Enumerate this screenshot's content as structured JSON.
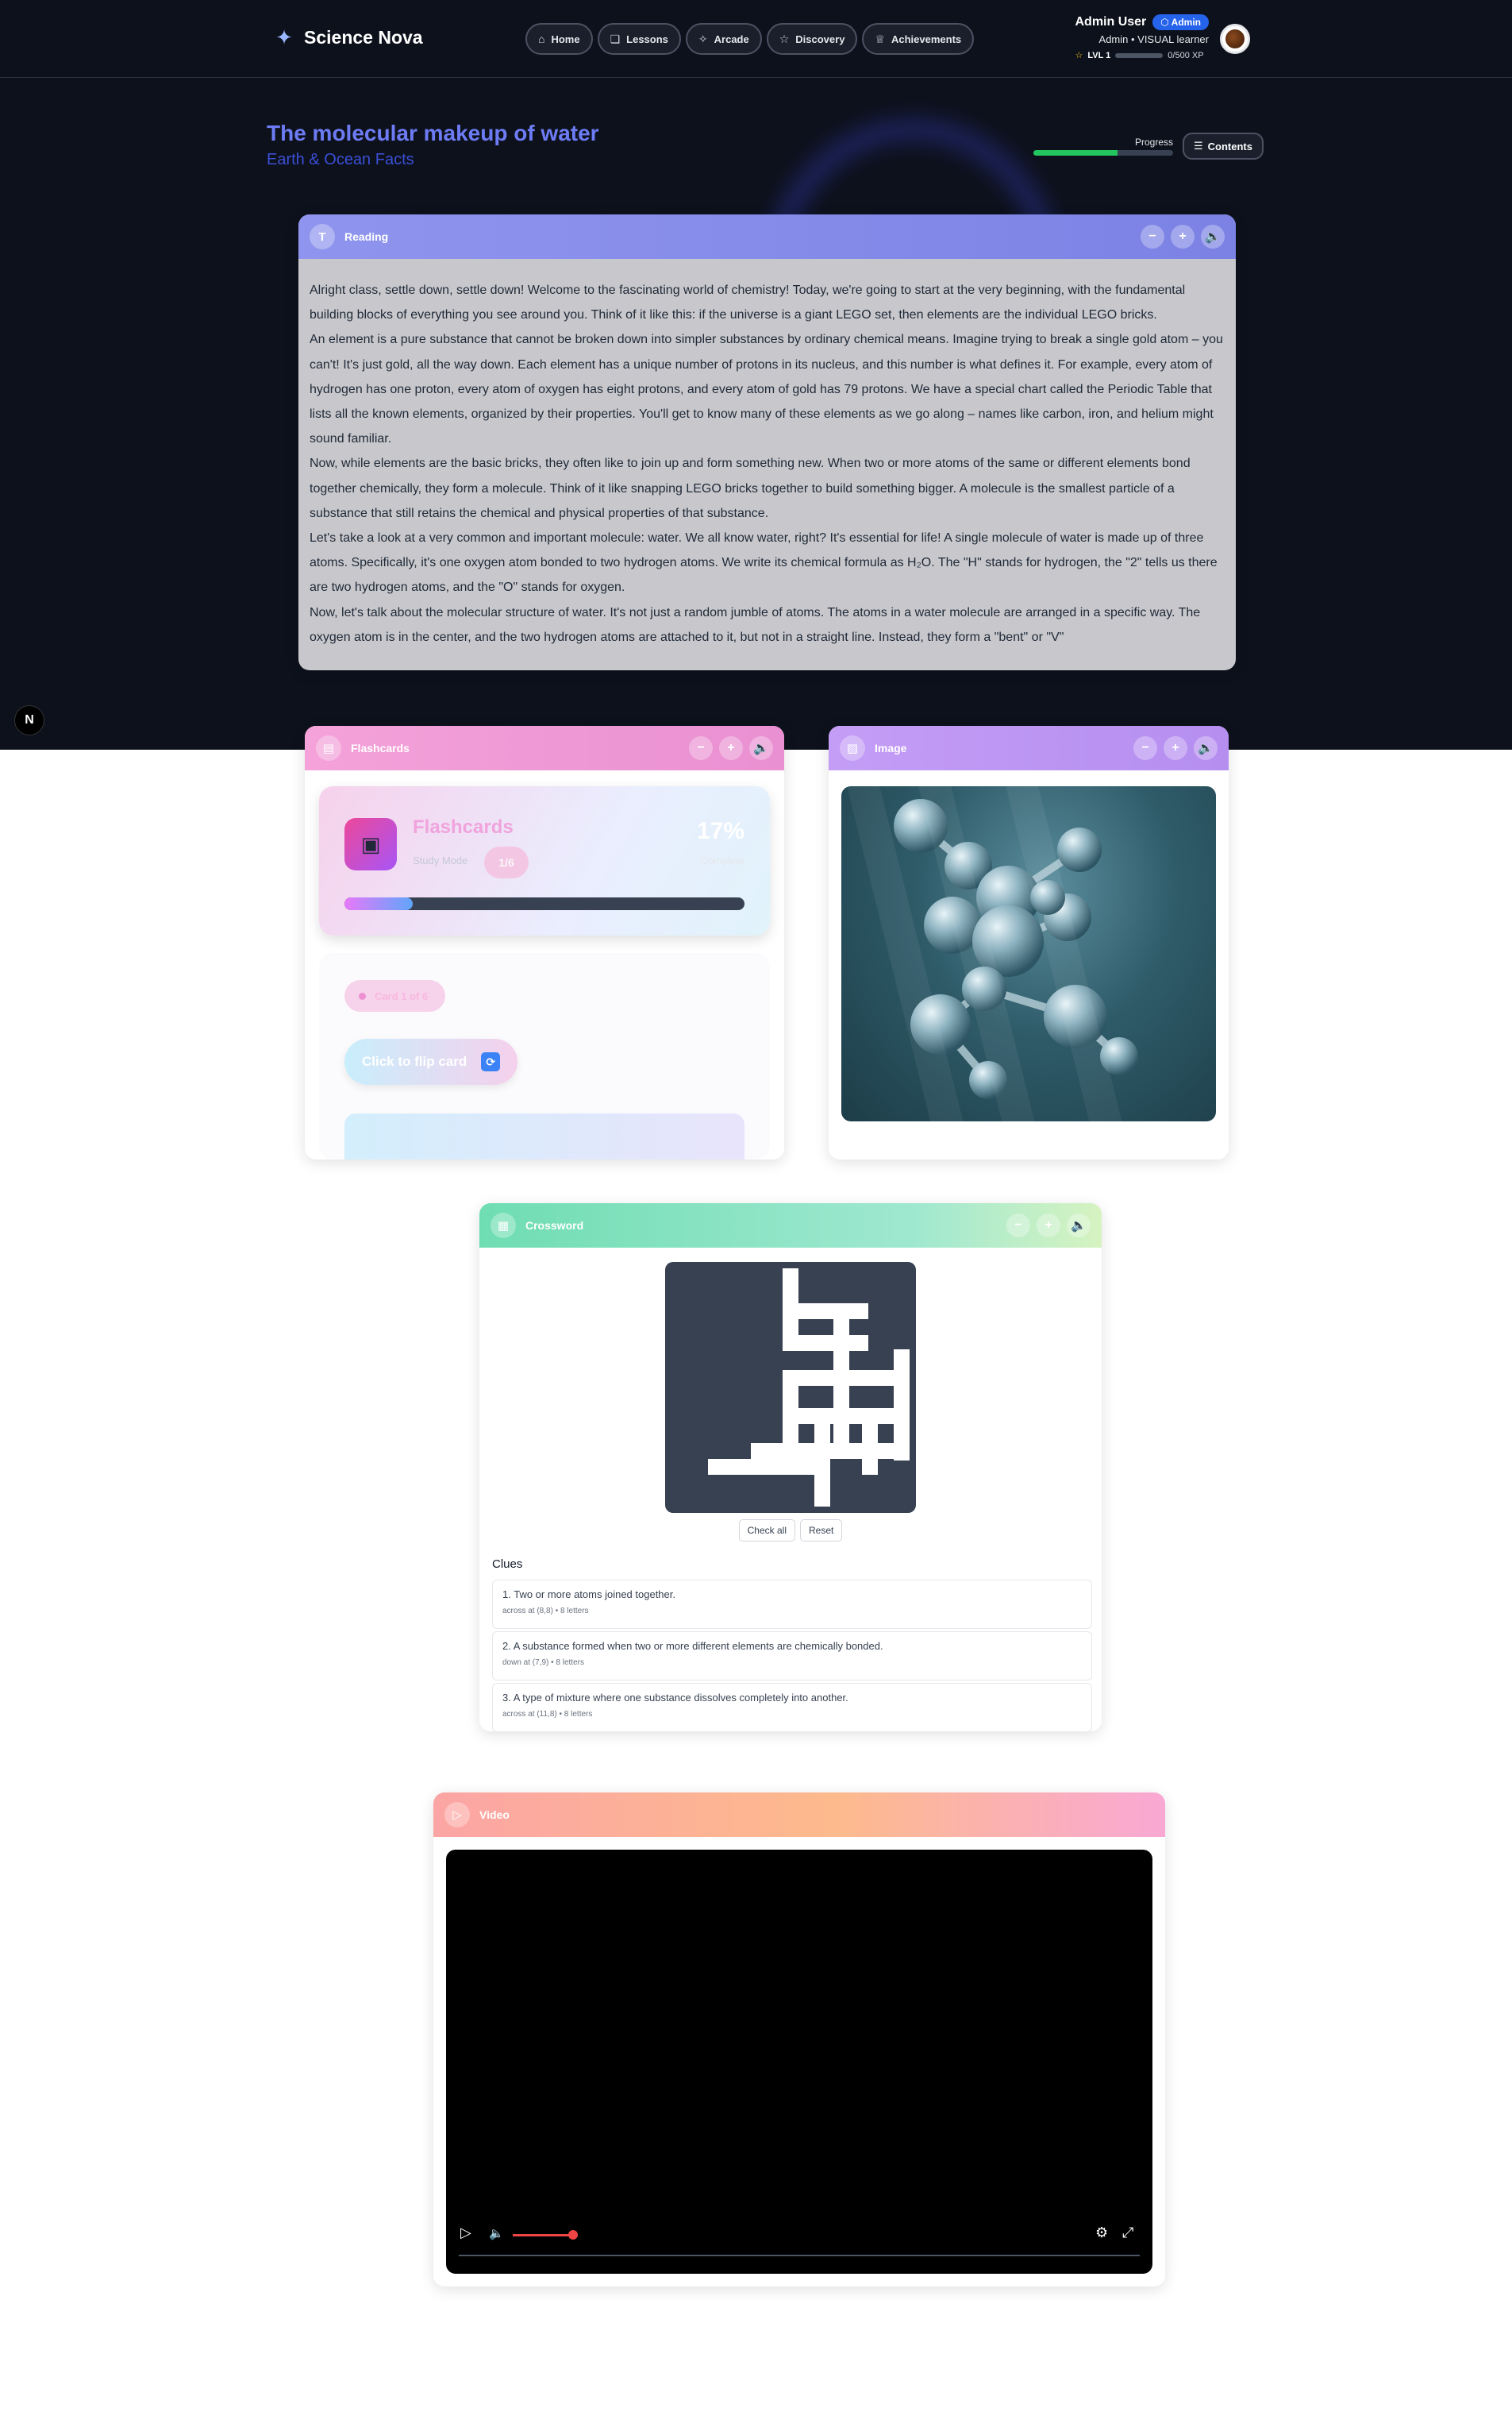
{
  "brand": {
    "name": "Science Nova",
    "icon": "sparkles-icon"
  },
  "nav": [
    {
      "label": "Home",
      "icon": "home-icon"
    },
    {
      "label": "Lessons",
      "icon": "book-icon"
    },
    {
      "label": "Arcade",
      "icon": "sparkles-icon"
    },
    {
      "label": "Discovery",
      "icon": "star-icon"
    },
    {
      "label": "Achievements",
      "icon": "trophy-icon"
    }
  ],
  "user": {
    "name": "Admin User",
    "badge": "Admin",
    "role": "Admin • VISUAL learner",
    "level": "LVL 1",
    "xp": "0/500 XP",
    "xp_fraction": 0.0
  },
  "lesson": {
    "title": "The molecular makeup of water",
    "subtitle": "Earth & Ocean Facts",
    "progress_label": "Progress",
    "progress_fraction": 0.6,
    "contents_label": "Contents"
  },
  "reading": {
    "header": "Reading",
    "paragraphs": [
      "Alright class, settle down, settle down! Welcome to the fascinating world of chemistry! Today, we're going to start at the very beginning, with the fundamental building blocks of everything you see around you. Think of it like this: if the universe is a giant LEGO set, then elements are the individual LEGO bricks.",
      "An element is a pure substance that cannot be broken down into simpler substances by ordinary chemical means. Imagine trying to break a single gold atom – you can't! It's just gold, all the way down. Each element has a unique number of protons in its nucleus, and this number is what defines it. For example, every atom of hydrogen has one proton, every atom of oxygen has eight protons, and every atom of gold has 79 protons. We have a special chart called the Periodic Table that lists all the known elements, organized by their properties. You'll get to know many of these elements as we go along – names like carbon, iron, and helium might sound familiar.",
      "Now, while elements are the basic bricks, they often like to join up and form something new. When two or more atoms of the same or different elements bond together chemically, they form a molecule. Think of it like snapping LEGO bricks together to build something bigger. A molecule is the smallest particle of a substance that still retains the chemical and physical properties of that substance.",
      "Let's take a look at a very common and important molecule: water. We all know water, right? It's essential for life! A single molecule of water is made up of three atoms. Specifically, it's one oxygen atom bonded to two hydrogen atoms. We write its chemical formula as H₂O. The \"H\" stands for hydrogen, the \"2\" tells us there are two hydrogen atoms, and the \"O\" stands for oxygen.",
      "Now, let's talk about the molecular structure of water. It's not just a random jumble of atoms. The atoms in a water molecule are arranged in a specific way. The oxygen atom is in the center, and the two hydrogen atoms are attached to it, but not in a straight line. Instead, they form a \"bent\" or \"V\""
    ]
  },
  "flashcards": {
    "header": "Flashcards",
    "title": "Flashcards",
    "mode": "Study Mode",
    "counter": "1/6",
    "percent": "17%",
    "percent_label": "Complete",
    "progress_fraction": 0.17,
    "card_label": "Card 1 of 6",
    "flip_label": "Click to flip card"
  },
  "image": {
    "header": "Image",
    "alt": "water molecule spheres underwater"
  },
  "crossword": {
    "header": "Crossword",
    "check_label": "Check all",
    "reset_label": "Reset",
    "clues_title": "Clues",
    "clues": [
      {
        "text": "1. Two or more atoms joined together.",
        "meta": "across at (8,8) • 8 letters"
      },
      {
        "text": "2. A substance formed when two or more different elements are chemically bonded.",
        "meta": "down at (7,9) • 8 letters"
      },
      {
        "text": "3. A type of mixture where one substance dissolves completely into another.",
        "meta": "across at (11,8) • 8 letters"
      }
    ]
  },
  "video": {
    "header": "Video",
    "volume_fraction": 0.95
  },
  "fab": {
    "label": "N"
  }
}
